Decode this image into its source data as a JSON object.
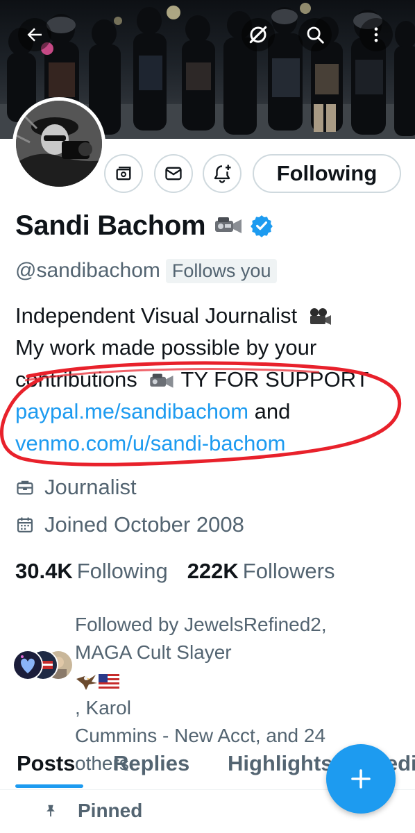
{
  "profile": {
    "name": "Sandi Bachom",
    "handle": "@sandibachom",
    "follows_you": "Follows you",
    "verified": true
  },
  "actions": {
    "following_label": "Following"
  },
  "bio": {
    "line1": "Independent Visual Journalist",
    "line2": "My work made possible by your",
    "line3": "contributions",
    "line3_tail": "TY FOR SUPPORT",
    "paypal_link": "paypal.me/sandibachom",
    "and": "and",
    "venmo_link": "venmo.com/u/sandi-bachom"
  },
  "meta": {
    "category": "Journalist",
    "joined": "Joined October 2008"
  },
  "stats": {
    "following_count": "30.4K",
    "following_label": "Following",
    "followers_count": "222K",
    "followers_label": "Followers"
  },
  "followed_by": {
    "line1": "Followed by JewelsRefined2,",
    "line2a": "MAGA Cult Slayer",
    "line2b": ", Karol",
    "line3": "Cummins - New Acct, and 24",
    "line4": "others"
  },
  "tabs": [
    {
      "label": "Posts",
      "active": true
    },
    {
      "label": "Replies",
      "active": false
    },
    {
      "label": "Highlights",
      "active": false
    },
    {
      "label": "Media",
      "active": false
    }
  ],
  "pinned_label": "Pinned",
  "icons": {
    "back": "arrow-left-icon",
    "grok": "grok-icon",
    "search": "search-icon",
    "more": "more-vertical-icon",
    "subscriptions": "subscriptions-icon",
    "message": "envelope-icon",
    "notify": "bell-plus-icon",
    "verified": "verified-badge-icon",
    "category": "briefcase-icon",
    "joined": "calendar-icon",
    "pin": "pin-icon",
    "compose": "plus-icon"
  },
  "colors": {
    "accent": "#1d9bf0",
    "text_primary": "#0f1419",
    "text_secondary": "#536471",
    "annotation_red": "#e8212b"
  }
}
